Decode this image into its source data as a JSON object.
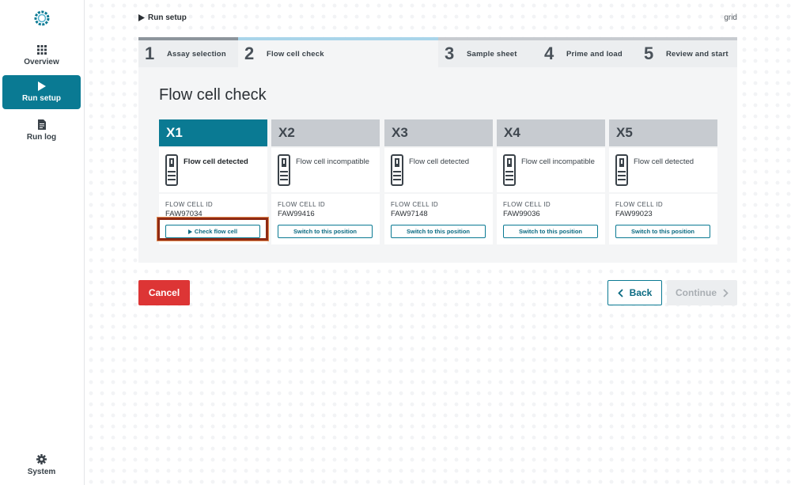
{
  "sidebar": {
    "items": [
      {
        "label": "Overview",
        "icon": "grid-icon",
        "active": false
      },
      {
        "label": "Run setup",
        "icon": "play-icon",
        "active": true
      },
      {
        "label": "Run log",
        "icon": "document-icon",
        "active": false
      }
    ],
    "system_label": "System"
  },
  "header": {
    "breadcrumb": "Run setup",
    "right_link": "grid"
  },
  "stepper": {
    "steps": [
      {
        "num": "1",
        "label": "Assay selection",
        "state": "done"
      },
      {
        "num": "2",
        "label": "Flow cell check",
        "state": "current"
      },
      {
        "num": "3",
        "label": "Sample sheet",
        "state": "todo"
      },
      {
        "num": "4",
        "label": "Prime and load",
        "state": "todo"
      },
      {
        "num": "5",
        "label": "Review and start",
        "state": "todo"
      }
    ]
  },
  "main": {
    "title": "Flow cell check",
    "id_label": "FLOW CELL ID",
    "positions": [
      {
        "name": "X1",
        "status": "Flow cell detected",
        "flow_cell_id": "FAW97034",
        "button": "Check flow cell",
        "active": true
      },
      {
        "name": "X2",
        "status": "Flow cell incompatible",
        "flow_cell_id": "FAW99416",
        "button": "Switch to this position",
        "active": false
      },
      {
        "name": "X3",
        "status": "Flow cell detected",
        "flow_cell_id": "FAW97148",
        "button": "Switch to this position",
        "active": false
      },
      {
        "name": "X4",
        "status": "Flow cell incompatible",
        "flow_cell_id": "FAW99036",
        "button": "Switch to this position",
        "active": false
      },
      {
        "name": "X5",
        "status": "Flow cell detected",
        "flow_cell_id": "FAW99023",
        "button": "Switch to this position",
        "active": false
      }
    ]
  },
  "footer": {
    "cancel_label": "Cancel",
    "back_label": "Back",
    "continue_label": "Continue"
  },
  "colors": {
    "accent": "#0a7a93",
    "danger": "#dd3535",
    "focus_ring": "#8f2a13"
  }
}
